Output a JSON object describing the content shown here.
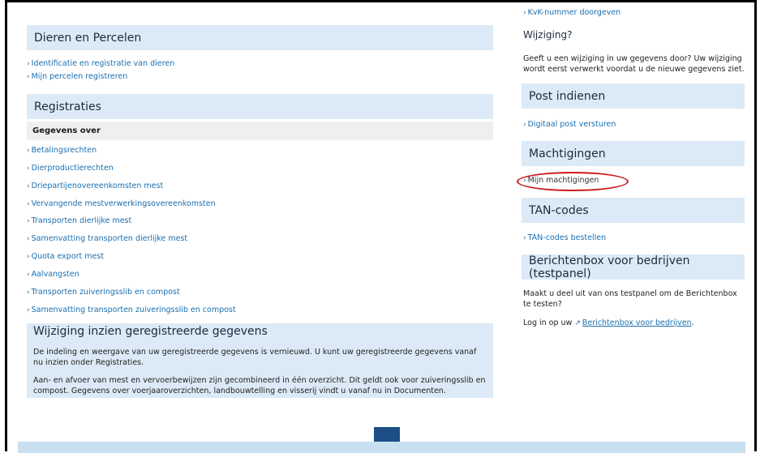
{
  "left": {
    "dieren_header": "Dieren en Percelen",
    "dieren_links": [
      "Identificatie en registratie van dieren",
      "Mijn percelen registreren"
    ],
    "registraties_header": "Registraties",
    "gegevens_over": "Gegevens over",
    "registratie_links": [
      "Betalingsrechten",
      "Dierproductierechten",
      "Driepartijenovereenkomsten mest",
      "Vervangende mestverwerkingsovereenkomsten",
      "Transporten dierlijke mest",
      "Samenvatting transporten dierlijke mest",
      "Quota export mest",
      "Aalvangsten",
      "Transporten zuiveringsslib en compost",
      "Samenvatting transporten zuiveringsslib en compost"
    ],
    "info_title": "Wijziging inzien geregistreerde gegevens",
    "info_p1": "De indeling en weergave van uw geregistreerde gegevens is vernieuwd. U kunt uw geregistreerde gegevens vanaf nu inzien onder Registraties.",
    "info_p2": "Aan- en afvoer van mest en vervoerbewijzen zijn gecombineerd in één overzicht. Dit geldt ook voor zuiveringsslib en compost. Gegevens over voerjaaroverzichten, landbouwtelling en visserij vindt u vanaf nu in Documenten."
  },
  "right": {
    "kvk_link": "KvK-nummer doorgeven",
    "wijziging_title": "Wijziging?",
    "wijziging_text": "Geeft u een wijziging in uw gegevens door? Uw wijziging wordt eerst verwerkt voordat u de nieuwe gegevens ziet.",
    "post_header": "Post indienen",
    "post_link": "Digitaal post versturen",
    "machtigingen_header": "Machtigingen",
    "machtigingen_link": "Mijn machtigingen",
    "tan_header": "TAN-codes",
    "tan_link": "TAN-codes bestellen",
    "berichtenbox_header": "Berichtenbox voor bedrijven (testpanel)",
    "berichtenbox_text": "Maakt u deel uit van ons testpanel om de Berichtenbox te testen?",
    "login_prefix": "Log in op uw",
    "login_link": "Berichtenbox voor bedrijven",
    "login_suffix": "."
  },
  "colors": {
    "link": "#1a6fb0",
    "header_bg": "#dbeaf6",
    "annotation": "#cc1a1a",
    "footer_tab": "#1d4f86"
  },
  "icons": {
    "link_chevron": "chevron-right-icon",
    "external": "external-link-icon"
  }
}
